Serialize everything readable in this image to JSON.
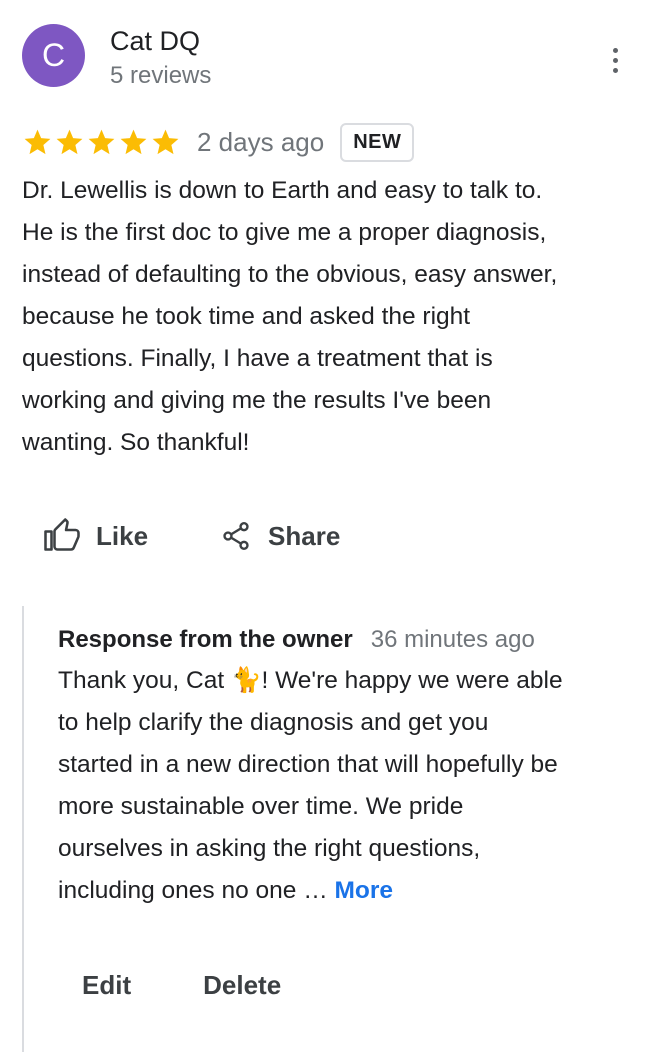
{
  "reviewer": {
    "avatar_letter": "C",
    "avatar_color": "#7e57c2",
    "name": "Cat DQ",
    "review_count": "5 reviews"
  },
  "review": {
    "rating": 5,
    "star_color": "#fbbc04",
    "date": "2 days ago",
    "badge": "NEW",
    "lines": [
      "Dr. Lewellis is down to Earth and easy to talk to.",
      "He is the first doc to give me a proper diagnosis,",
      "instead of defaulting to the obvious, easy answer,",
      "because he took time and asked the right",
      "questions. Finally, I have a treatment that is",
      "working and giving me the results I've been",
      "wanting. So thankful!"
    ]
  },
  "actions": {
    "like_label": "Like",
    "share_label": "Share"
  },
  "owner_response": {
    "title": "Response from the owner",
    "time": "36 minutes ago",
    "line1_prefix": "Thank you, Cat ",
    "cat_emoji": "🐈",
    "line1_suffix": "! We're happy we were able",
    "lines": [
      "to help clarify the diagnosis and get you",
      "started in a new direction that will hopefully be",
      "more sustainable over time. We pride",
      "ourselves in asking the right questions,"
    ],
    "last_line": "including ones no one … ",
    "more_label": "More",
    "more_color": "#1a73e8",
    "edit_label": "Edit",
    "delete_label": "Delete"
  }
}
